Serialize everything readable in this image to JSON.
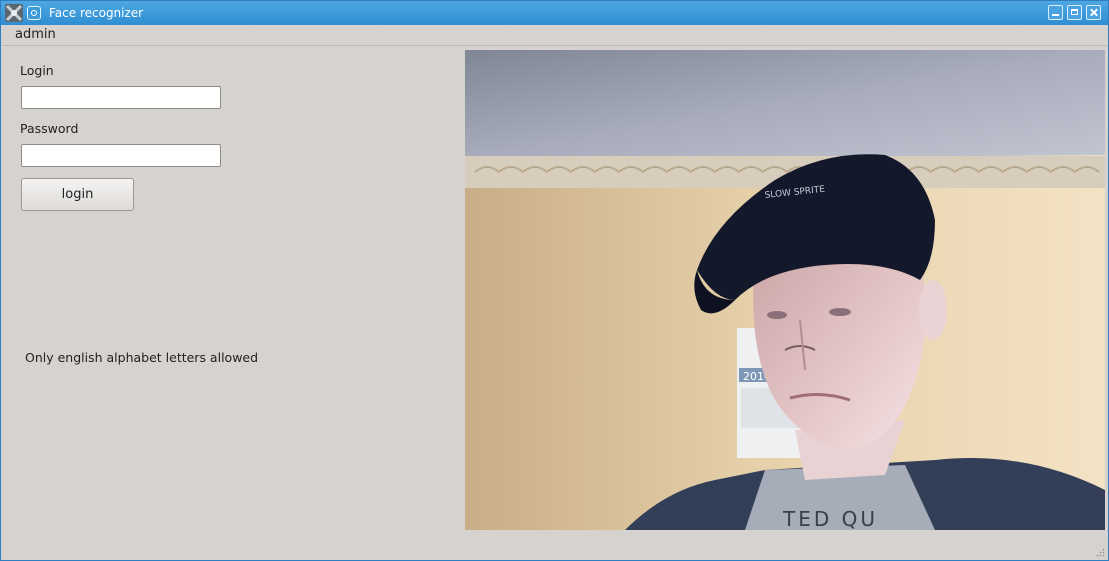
{
  "window": {
    "title": "Face recognizer",
    "accent_color": "#3a96d8"
  },
  "menu": {
    "items": [
      {
        "label": "admin"
      }
    ]
  },
  "form": {
    "login_label": "Login",
    "login_value": "",
    "password_label": "Password",
    "password_value": "",
    "submit_label": "login"
  },
  "hint": "Only english alphabet letters allowed",
  "camera": {
    "content": "webcam-feed",
    "calendar_year": "2014",
    "cap_text": "SLOW SPRITE",
    "shirt_text": "TED QU"
  }
}
